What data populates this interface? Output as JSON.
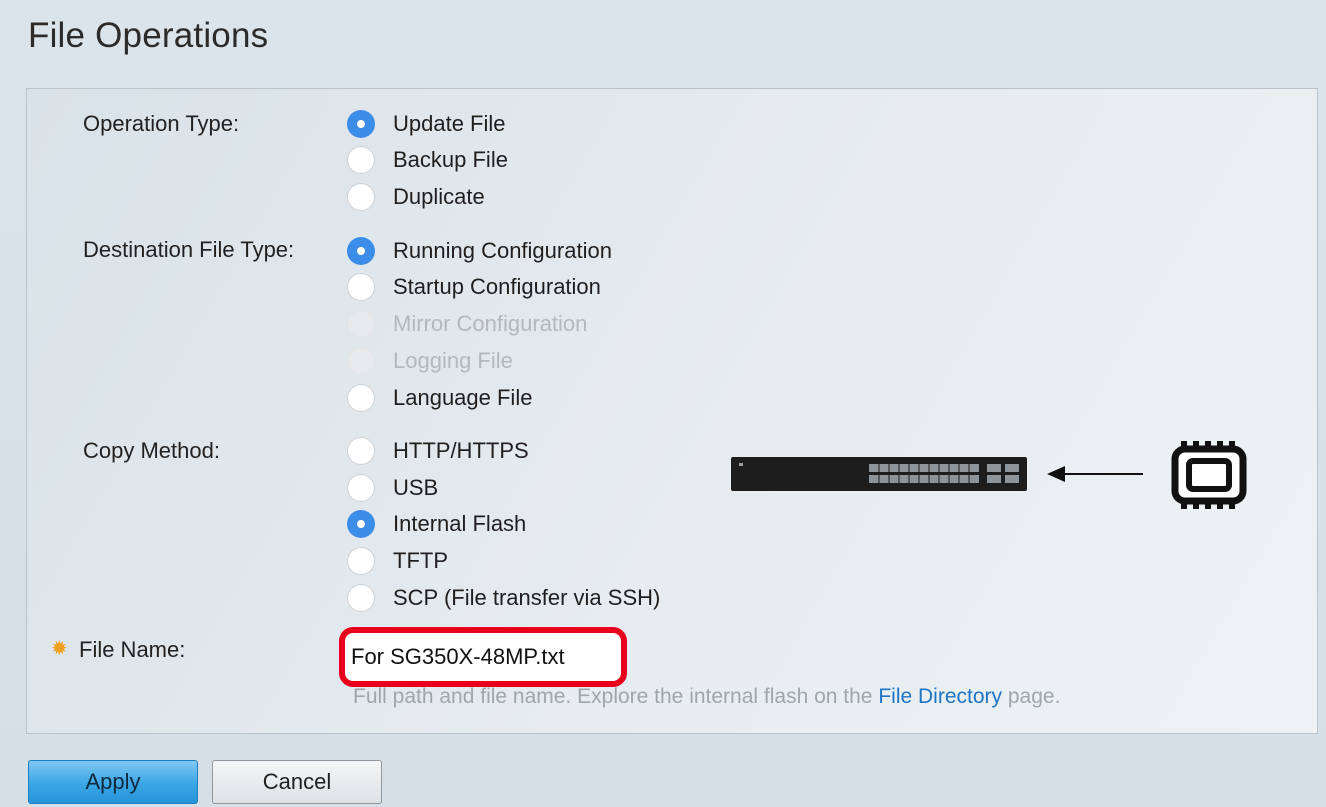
{
  "page": {
    "title": "File Operations"
  },
  "operation_type": {
    "label": "Operation Type:",
    "options": [
      {
        "label": "Update File",
        "checked": true,
        "disabled": false
      },
      {
        "label": "Backup File",
        "checked": false,
        "disabled": false
      },
      {
        "label": "Duplicate",
        "checked": false,
        "disabled": false
      }
    ]
  },
  "destination_file_type": {
    "label": "Destination File Type:",
    "options": [
      {
        "label": "Running Configuration",
        "checked": true,
        "disabled": false
      },
      {
        "label": "Startup Configuration",
        "checked": false,
        "disabled": false
      },
      {
        "label": "Mirror Configuration",
        "checked": false,
        "disabled": true
      },
      {
        "label": "Logging File",
        "checked": false,
        "disabled": true
      },
      {
        "label": "Language File",
        "checked": false,
        "disabled": false
      }
    ]
  },
  "copy_method": {
    "label": "Copy Method:",
    "options": [
      {
        "label": "HTTP/HTTPS",
        "checked": false,
        "disabled": false
      },
      {
        "label": "USB",
        "checked": false,
        "disabled": false
      },
      {
        "label": "Internal Flash",
        "checked": true,
        "disabled": false
      },
      {
        "label": "TFTP",
        "checked": false,
        "disabled": false
      },
      {
        "label": "SCP (File transfer via SSH)",
        "checked": false,
        "disabled": false
      }
    ]
  },
  "file_name": {
    "label": "File Name:",
    "value": "For SG350X-48MP.txt",
    "hint_prefix": "Full path and file name. Explore the internal flash on the ",
    "hint_link": "File Directory",
    "hint_suffix": " page."
  },
  "buttons": {
    "apply": "Apply",
    "cancel": "Cancel"
  },
  "colors": {
    "accent": "#3b8de8",
    "highlight_border": "#e8001c",
    "link": "#1e74c5",
    "required_icon": "#f0a020"
  },
  "icons": {
    "required": "gear-icon",
    "switch": "network-switch-icon",
    "arrow": "arrow-left-icon",
    "flash": "flash-memory-chip-icon"
  }
}
